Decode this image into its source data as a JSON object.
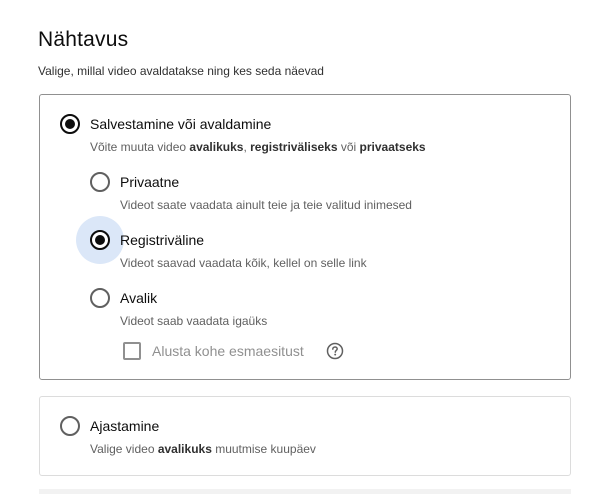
{
  "section": {
    "title": "Nähtavus",
    "subtitle": "Valige, millal video avaldatakse ning kes seda näevad"
  },
  "save_publish": {
    "label": "Salvestamine või avaldamine",
    "desc_prefix": "Võite muuta video ",
    "desc_public": "avalikuks",
    "desc_sep": ", ",
    "desc_unlisted": "registriväliseks",
    "desc_or": " või ",
    "desc_private": "privaatseks",
    "selected": true
  },
  "options": [
    {
      "label": "Privaatne",
      "desc": "Videot saate vaadata ainult teie ja teie valitud inimesed",
      "selected": false
    },
    {
      "label": "Registriväline",
      "desc": "Videot saavad vaadata kõik, kellel on selle link",
      "selected": true
    },
    {
      "label": "Avalik",
      "desc": "Videot saab vaadata igaüks",
      "selected": false
    }
  ],
  "premiere": {
    "label": "Alusta kohe esmaesitust",
    "checked": false,
    "help_icon": "question-circle-icon"
  },
  "schedule": {
    "label": "Ajastamine",
    "desc_prefix": "Valige video ",
    "desc_bold": "avalikuks",
    "desc_suffix": " muutmise kuupäev",
    "selected": false
  },
  "colors": {
    "accent_halo": "#dbe7f8",
    "text_primary": "#0d0d0d",
    "text_secondary": "#606060"
  }
}
